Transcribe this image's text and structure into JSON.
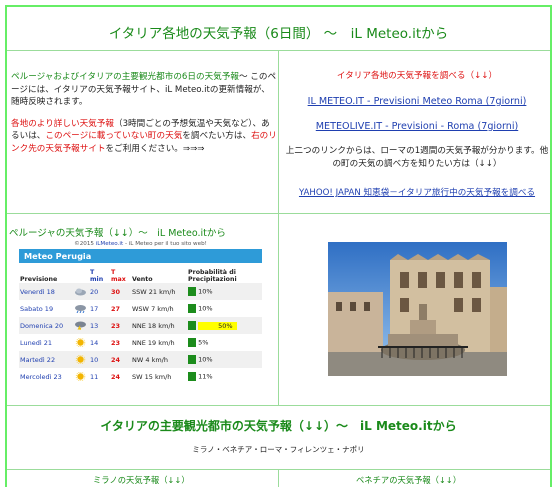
{
  "page": {
    "title": "イタリア各地の天気予報（6日間） 〜　iL Meteo.itから"
  },
  "intro": {
    "line1_green": "ペルージャおよびイタリアの主要観光都市の6日の天気予報",
    "line1_rest": "〜 このページには、イタリアの天気予報サイト、iL Meteo.itの更新情報が、随時反映されます。",
    "red_a": "各地のより詳しい天気予報",
    "text_b": "（3時間ごとの予想気温や天気など）、あるいは、",
    "red_c": "このページに載っていない町の天気",
    "text_d": "を調べたい方は、",
    "red_e": "右のリンク先の天気予報サイト",
    "text_f": "をご利用ください。⇒⇒⇒"
  },
  "links": {
    "heading": "イタリア各地の天気予報を調べる（↓↓）",
    "link1": "IL METEO.IT - Previsioni Meteo Roma (7giorni)",
    "link2": "METEOLIVE.IT - Previsioni - Roma (7giorni)",
    "note": "上二つのリンクからは、ローマの1週間の天気予報が分かります。他の町の天気の調べ方を知りたい方は（↓↓）",
    "link3": "YAHOO! JAPAN 知恵袋－イタリア旅行中の天気予報を調べる"
  },
  "perugia": {
    "section_title": "ペルージャの天気予報（↓↓）〜　iL Meteo.itから",
    "credit_prefix": "©2015 ",
    "credit_link": "iLMeteo.it",
    "credit_suffix": " - iL Meteo per il tuo sito web!",
    "widget_title": "Meteo Perugia",
    "headers": {
      "day": "Previsione",
      "tmin": "T min",
      "tmax": "T max",
      "wind": "Vento",
      "prob": "Probabilità di Precipitazioni"
    },
    "rows": [
      {
        "day": "Venerdì 18",
        "icon": "cloud-icon",
        "tmin": "20",
        "tmax": "30",
        "dir": "SSW",
        "speed": "21 km/h",
        "prob": "10%"
      },
      {
        "day": "Sabato 19",
        "icon": "cloud-rain-icon",
        "tmin": "17",
        "tmax": "27",
        "dir": "WSW",
        "speed": "7 km/h",
        "prob": "10%"
      },
      {
        "day": "Domenica 20",
        "icon": "thunderstorm-icon",
        "tmin": "13",
        "tmax": "23",
        "dir": "NNE",
        "speed": "18 km/h",
        "prob": "50%"
      },
      {
        "day": "Lunedì 21",
        "icon": "sun-icon",
        "tmin": "14",
        "tmax": "23",
        "dir": "NNE",
        "speed": "19 km/h",
        "prob": "5%"
      },
      {
        "day": "Martedì 22",
        "icon": "sun-icon",
        "tmin": "10",
        "tmax": "24",
        "dir": "NW",
        "speed": "4 km/h",
        "prob": "10%"
      },
      {
        "day": "Mercoledì 23",
        "icon": "sun-icon",
        "tmin": "11",
        "tmax": "24",
        "dir": "SW",
        "speed": "15 km/h",
        "prob": "11%"
      }
    ]
  },
  "main_section": {
    "title": "イタリアの主要観光都市の天気予報（↓↓）〜　iL Meteo.itから",
    "cities": "ミラノ・ベネチア・ローマ・フィレンツェ・ナポリ"
  },
  "subsections": {
    "left": "ミラノの天気予報（↓↓）",
    "right": "ベネチアの天気予報（↓↓）"
  }
}
